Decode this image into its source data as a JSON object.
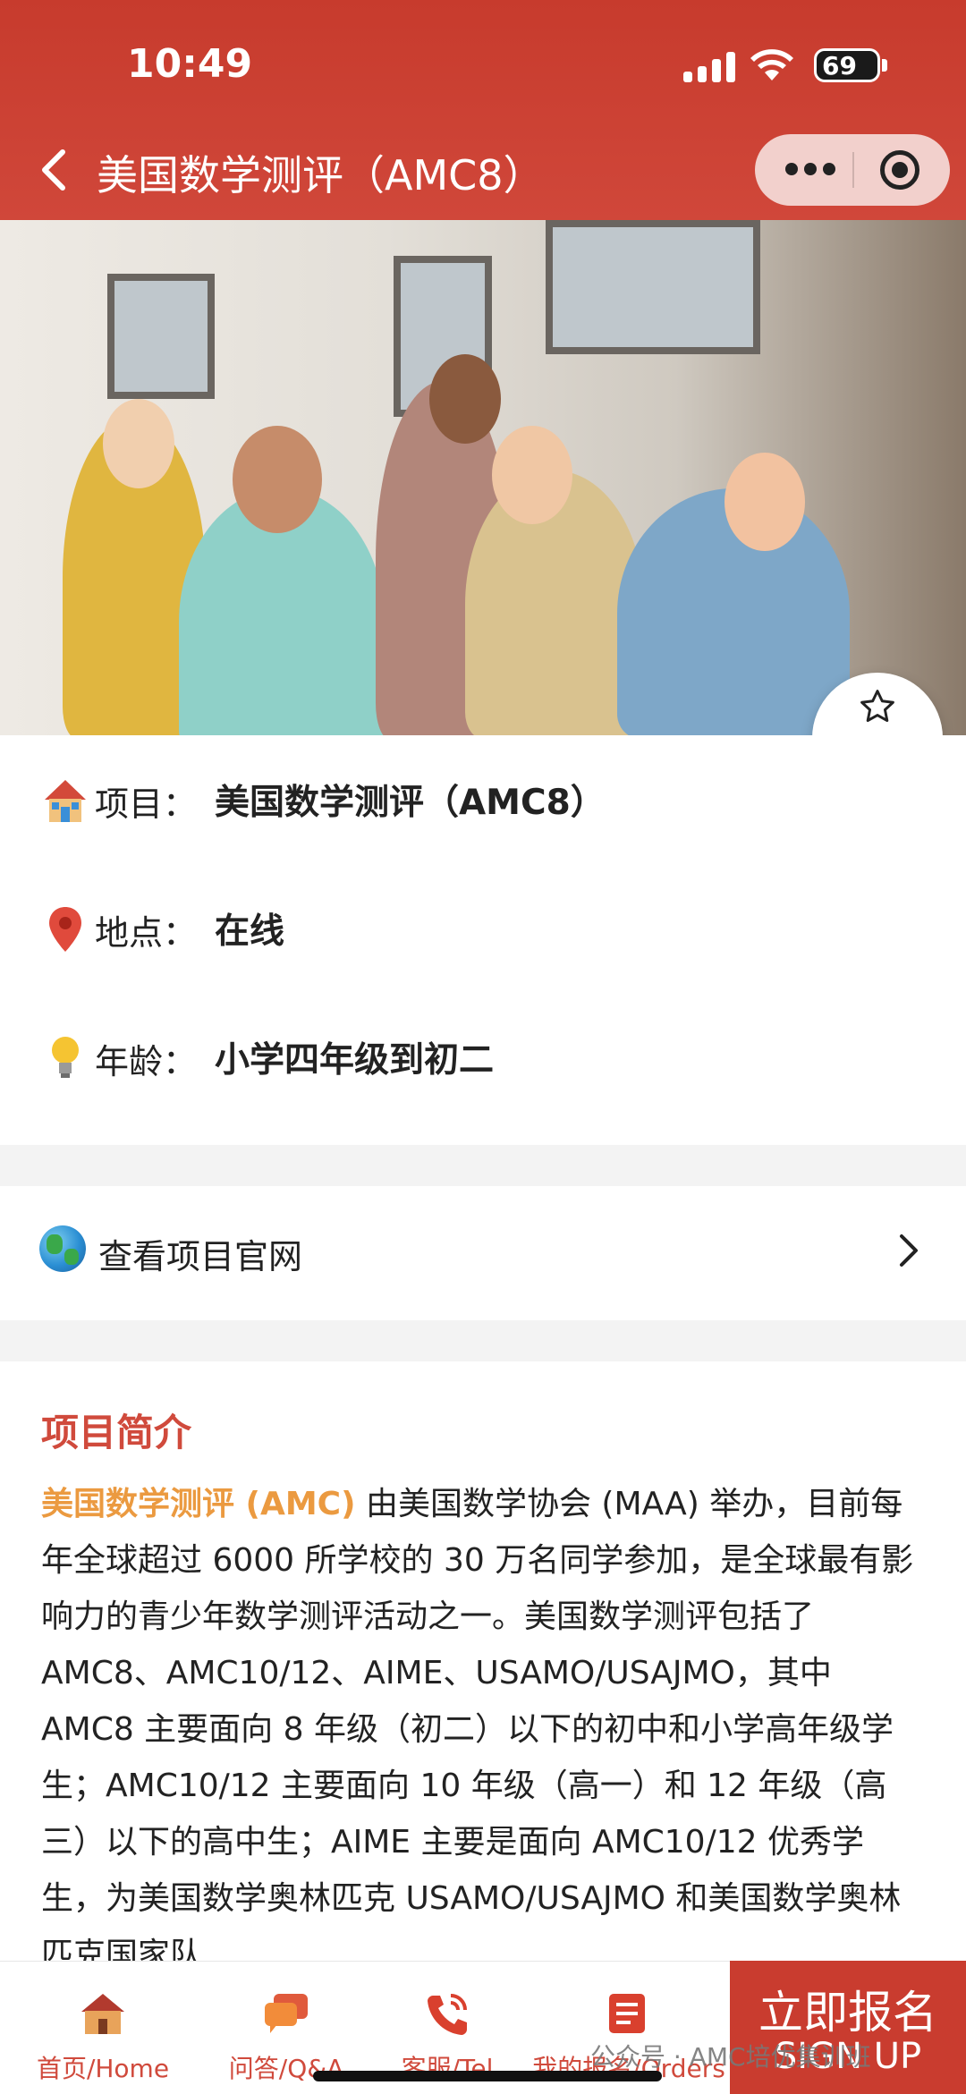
{
  "status_bar": {
    "time": "10:49",
    "battery": "69"
  },
  "nav": {
    "title": "美国数学测评（AMC8）"
  },
  "favorite": {
    "label": "收藏"
  },
  "info": {
    "project_label": "项目：",
    "project_value": "美国数学测评（AMC8）",
    "location_label": "地点：",
    "location_value": "在线",
    "age_label": "年龄：",
    "age_value": "小学四年级到初二"
  },
  "official_site": {
    "label": "查看项目官网"
  },
  "intro": {
    "title": "项目简介",
    "highlight": "美国数学测评 (AMC)",
    "text": " 由美国数学协会 (MAA) 举办，目前每年全球超过 6000 所学校的 30 万名同学参加，是全球最有影响力的青少年数学测评活动之一。美国数学测评包括了 AMC8、AMC10/12、AIME、USAMO/USAJMO，其中 AMC8 主要面向 8 年级（初二）以下的初中和小学高年级学生；AMC10/12 主要面向 10 年级（高一）和 12 年级（高三）以下的高中生；AIME 主要是面向 AMC10/12 优秀学生，为美国数学奥林匹克 USAMO/USAJMO 和美国数学奥林匹克国家队"
  },
  "tabbar": {
    "tabs": [
      {
        "label": "首页/Home",
        "icon": "home-icon"
      },
      {
        "label": "问答/Q&A",
        "icon": "chat-icon"
      },
      {
        "label": "客服/Tel",
        "icon": "phone-icon"
      },
      {
        "label": "我的报名/Orders",
        "icon": "orders-icon"
      }
    ],
    "signup_cn": "立即报名",
    "signup_en": "SIGN UP"
  },
  "watermark": "公众号 · AMC培优集训班",
  "colors": {
    "brand": "#c93c2f",
    "highlight": "#eb9a40"
  }
}
